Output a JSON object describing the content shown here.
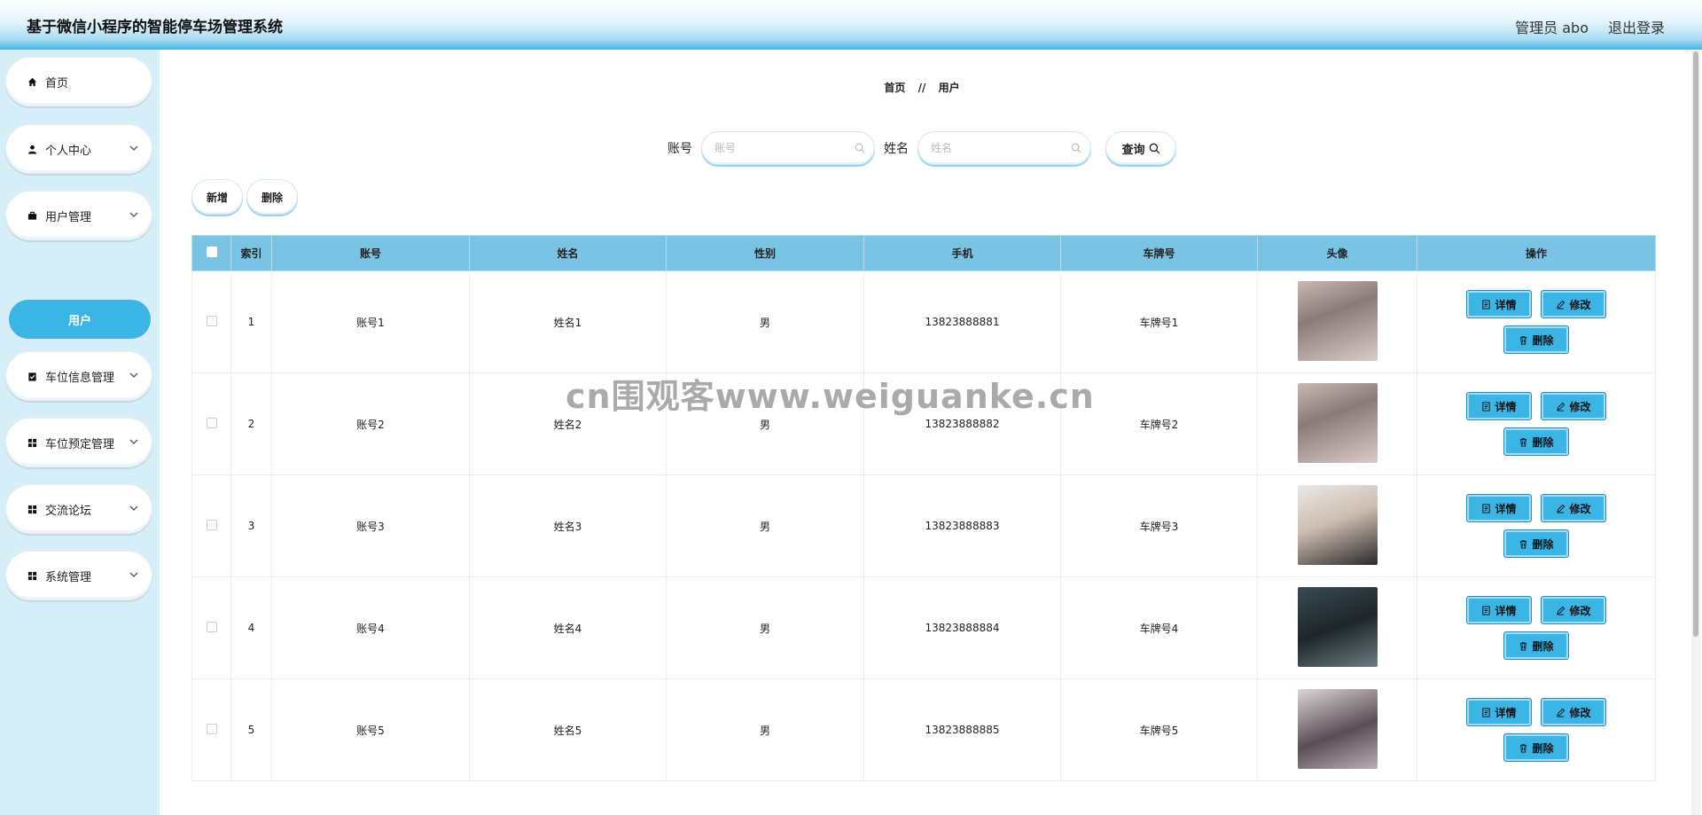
{
  "header": {
    "title": "基于微信小程序的智能停车场管理系统",
    "user": "管理员 abo",
    "logout": "退出登录"
  },
  "sidebar": {
    "items": [
      {
        "label": "首页",
        "icon": "home-icon",
        "expandable": false
      },
      {
        "label": "个人中心",
        "icon": "user-icon",
        "expandable": true
      },
      {
        "label": "用户管理",
        "icon": "briefcase-icon",
        "expandable": true
      },
      {
        "label": "车位信息管理",
        "icon": "clipboard-check-icon",
        "expandable": true
      },
      {
        "label": "车位预定管理",
        "icon": "grid-icon",
        "expandable": true
      },
      {
        "label": "交流论坛",
        "icon": "grid-icon",
        "expandable": true
      },
      {
        "label": "系统管理",
        "icon": "grid-icon",
        "expandable": true
      }
    ],
    "active_sub": "用户"
  },
  "breadcrumb": {
    "home": "首页",
    "sep": "//",
    "current": "用户"
  },
  "search": {
    "account_label": "账号",
    "account_placeholder": "账号",
    "name_label": "姓名",
    "name_placeholder": "姓名",
    "query_label": "查询"
  },
  "actions": {
    "add": "新增",
    "delete": "删除"
  },
  "table": {
    "columns": [
      "索引",
      "账号",
      "姓名",
      "性别",
      "手机",
      "车牌号",
      "头像",
      "操作"
    ],
    "rows": [
      {
        "index": "1",
        "account": "账号1",
        "name": "姓名1",
        "gender": "男",
        "phone": "13823888881",
        "plate": "车牌号1"
      },
      {
        "index": "2",
        "account": "账号2",
        "name": "姓名2",
        "gender": "男",
        "phone": "13823888882",
        "plate": "车牌号2"
      },
      {
        "index": "3",
        "account": "账号3",
        "name": "姓名3",
        "gender": "男",
        "phone": "13823888883",
        "plate": "车牌号3"
      },
      {
        "index": "4",
        "account": "账号4",
        "name": "姓名4",
        "gender": "男",
        "phone": "13823888884",
        "plate": "车牌号4"
      },
      {
        "index": "5",
        "account": "账号5",
        "name": "姓名5",
        "gender": "男",
        "phone": "13823888885",
        "plate": "车牌号5"
      }
    ],
    "row_actions": {
      "detail": "详情",
      "edit": "修改",
      "delete": "删除"
    }
  },
  "watermark": "cn围观客www.weiguanke.cn",
  "colors": {
    "accent": "#3bb4e6",
    "header_row": "#79c4e4",
    "sidebar_bg": "#d6eef8"
  }
}
